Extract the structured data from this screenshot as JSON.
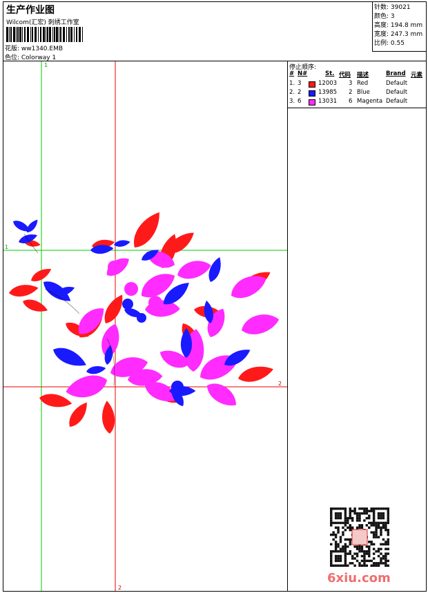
{
  "header": {
    "title": "生产作业图",
    "subtitle": "Wilcom(汇宏) 刺绣工作室",
    "design_line": "花版: ww1340.EMB",
    "colorway_line": "色位: Colorway 1"
  },
  "stats": [
    {
      "label": "针数:",
      "value": "39021"
    },
    {
      "label": "颜色:",
      "value": "3"
    },
    {
      "label": "高度:",
      "value": "194.8 mm"
    },
    {
      "label": "宽度:",
      "value": "247.3 mm"
    },
    {
      "label": "比例:",
      "value": "0.55"
    }
  ],
  "sequence": {
    "title": "停止顺序:",
    "columns": [
      "#",
      "N#",
      "St.",
      "代码",
      "描述",
      "Brand",
      "元素"
    ],
    "rows": [
      {
        "index": "1.",
        "n": "3",
        "st": "12003",
        "code": "3",
        "desc": "Red",
        "brand": "Default",
        "color": "#ff1a1a"
      },
      {
        "index": "2.",
        "n": "2",
        "st": "13985",
        "code": "2",
        "desc": "Blue",
        "brand": "Default",
        "color": "#1a1aff"
      },
      {
        "index": "3.",
        "n": "6",
        "st": "13031",
        "code": "6",
        "desc": "Magenta",
        "brand": "Default",
        "color": "#ff2bff"
      }
    ]
  },
  "guides": {
    "v1": "1",
    "v2": "2",
    "h1": "1",
    "h2": "2",
    "color_1": "#00cc00",
    "color_2": "#ee0000"
  },
  "watermark": "6xiu.com"
}
